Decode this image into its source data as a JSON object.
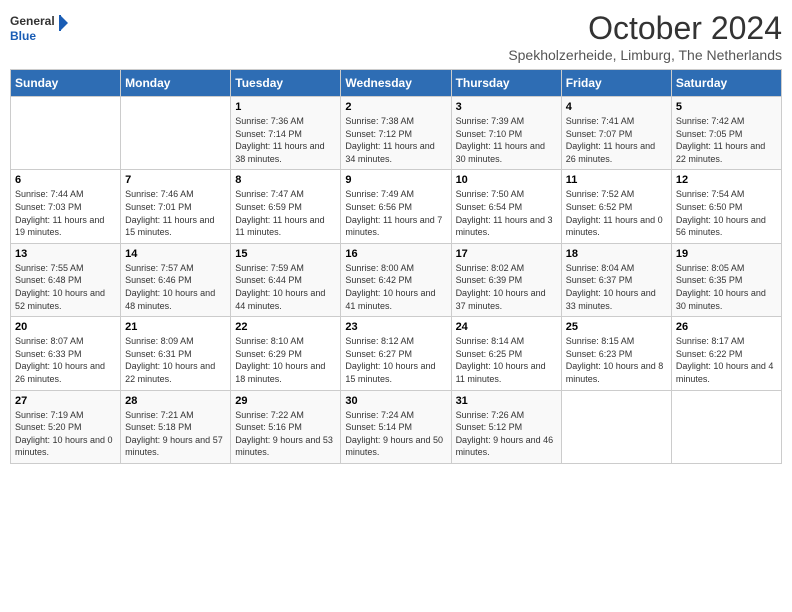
{
  "logo": {
    "line1": "General",
    "line2": "Blue"
  },
  "title": "October 2024",
  "subtitle": "Spekholzerheide, Limburg, The Netherlands",
  "days_of_week": [
    "Sunday",
    "Monday",
    "Tuesday",
    "Wednesday",
    "Thursday",
    "Friday",
    "Saturday"
  ],
  "weeks": [
    [
      {
        "day": null,
        "info": ""
      },
      {
        "day": null,
        "info": ""
      },
      {
        "day": "1",
        "info": "Sunrise: 7:36 AM\nSunset: 7:14 PM\nDaylight: 11 hours and 38 minutes."
      },
      {
        "day": "2",
        "info": "Sunrise: 7:38 AM\nSunset: 7:12 PM\nDaylight: 11 hours and 34 minutes."
      },
      {
        "day": "3",
        "info": "Sunrise: 7:39 AM\nSunset: 7:10 PM\nDaylight: 11 hours and 30 minutes."
      },
      {
        "day": "4",
        "info": "Sunrise: 7:41 AM\nSunset: 7:07 PM\nDaylight: 11 hours and 26 minutes."
      },
      {
        "day": "5",
        "info": "Sunrise: 7:42 AM\nSunset: 7:05 PM\nDaylight: 11 hours and 22 minutes."
      }
    ],
    [
      {
        "day": "6",
        "info": "Sunrise: 7:44 AM\nSunset: 7:03 PM\nDaylight: 11 hours and 19 minutes."
      },
      {
        "day": "7",
        "info": "Sunrise: 7:46 AM\nSunset: 7:01 PM\nDaylight: 11 hours and 15 minutes."
      },
      {
        "day": "8",
        "info": "Sunrise: 7:47 AM\nSunset: 6:59 PM\nDaylight: 11 hours and 11 minutes."
      },
      {
        "day": "9",
        "info": "Sunrise: 7:49 AM\nSunset: 6:56 PM\nDaylight: 11 hours and 7 minutes."
      },
      {
        "day": "10",
        "info": "Sunrise: 7:50 AM\nSunset: 6:54 PM\nDaylight: 11 hours and 3 minutes."
      },
      {
        "day": "11",
        "info": "Sunrise: 7:52 AM\nSunset: 6:52 PM\nDaylight: 11 hours and 0 minutes."
      },
      {
        "day": "12",
        "info": "Sunrise: 7:54 AM\nSunset: 6:50 PM\nDaylight: 10 hours and 56 minutes."
      }
    ],
    [
      {
        "day": "13",
        "info": "Sunrise: 7:55 AM\nSunset: 6:48 PM\nDaylight: 10 hours and 52 minutes."
      },
      {
        "day": "14",
        "info": "Sunrise: 7:57 AM\nSunset: 6:46 PM\nDaylight: 10 hours and 48 minutes."
      },
      {
        "day": "15",
        "info": "Sunrise: 7:59 AM\nSunset: 6:44 PM\nDaylight: 10 hours and 44 minutes."
      },
      {
        "day": "16",
        "info": "Sunrise: 8:00 AM\nSunset: 6:42 PM\nDaylight: 10 hours and 41 minutes."
      },
      {
        "day": "17",
        "info": "Sunrise: 8:02 AM\nSunset: 6:39 PM\nDaylight: 10 hours and 37 minutes."
      },
      {
        "day": "18",
        "info": "Sunrise: 8:04 AM\nSunset: 6:37 PM\nDaylight: 10 hours and 33 minutes."
      },
      {
        "day": "19",
        "info": "Sunrise: 8:05 AM\nSunset: 6:35 PM\nDaylight: 10 hours and 30 minutes."
      }
    ],
    [
      {
        "day": "20",
        "info": "Sunrise: 8:07 AM\nSunset: 6:33 PM\nDaylight: 10 hours and 26 minutes."
      },
      {
        "day": "21",
        "info": "Sunrise: 8:09 AM\nSunset: 6:31 PM\nDaylight: 10 hours and 22 minutes."
      },
      {
        "day": "22",
        "info": "Sunrise: 8:10 AM\nSunset: 6:29 PM\nDaylight: 10 hours and 18 minutes."
      },
      {
        "day": "23",
        "info": "Sunrise: 8:12 AM\nSunset: 6:27 PM\nDaylight: 10 hours and 15 minutes."
      },
      {
        "day": "24",
        "info": "Sunrise: 8:14 AM\nSunset: 6:25 PM\nDaylight: 10 hours and 11 minutes."
      },
      {
        "day": "25",
        "info": "Sunrise: 8:15 AM\nSunset: 6:23 PM\nDaylight: 10 hours and 8 minutes."
      },
      {
        "day": "26",
        "info": "Sunrise: 8:17 AM\nSunset: 6:22 PM\nDaylight: 10 hours and 4 minutes."
      }
    ],
    [
      {
        "day": "27",
        "info": "Sunrise: 7:19 AM\nSunset: 5:20 PM\nDaylight: 10 hours and 0 minutes."
      },
      {
        "day": "28",
        "info": "Sunrise: 7:21 AM\nSunset: 5:18 PM\nDaylight: 9 hours and 57 minutes."
      },
      {
        "day": "29",
        "info": "Sunrise: 7:22 AM\nSunset: 5:16 PM\nDaylight: 9 hours and 53 minutes."
      },
      {
        "day": "30",
        "info": "Sunrise: 7:24 AM\nSunset: 5:14 PM\nDaylight: 9 hours and 50 minutes."
      },
      {
        "day": "31",
        "info": "Sunrise: 7:26 AM\nSunset: 5:12 PM\nDaylight: 9 hours and 46 minutes."
      },
      {
        "day": null,
        "info": ""
      },
      {
        "day": null,
        "info": ""
      }
    ]
  ]
}
